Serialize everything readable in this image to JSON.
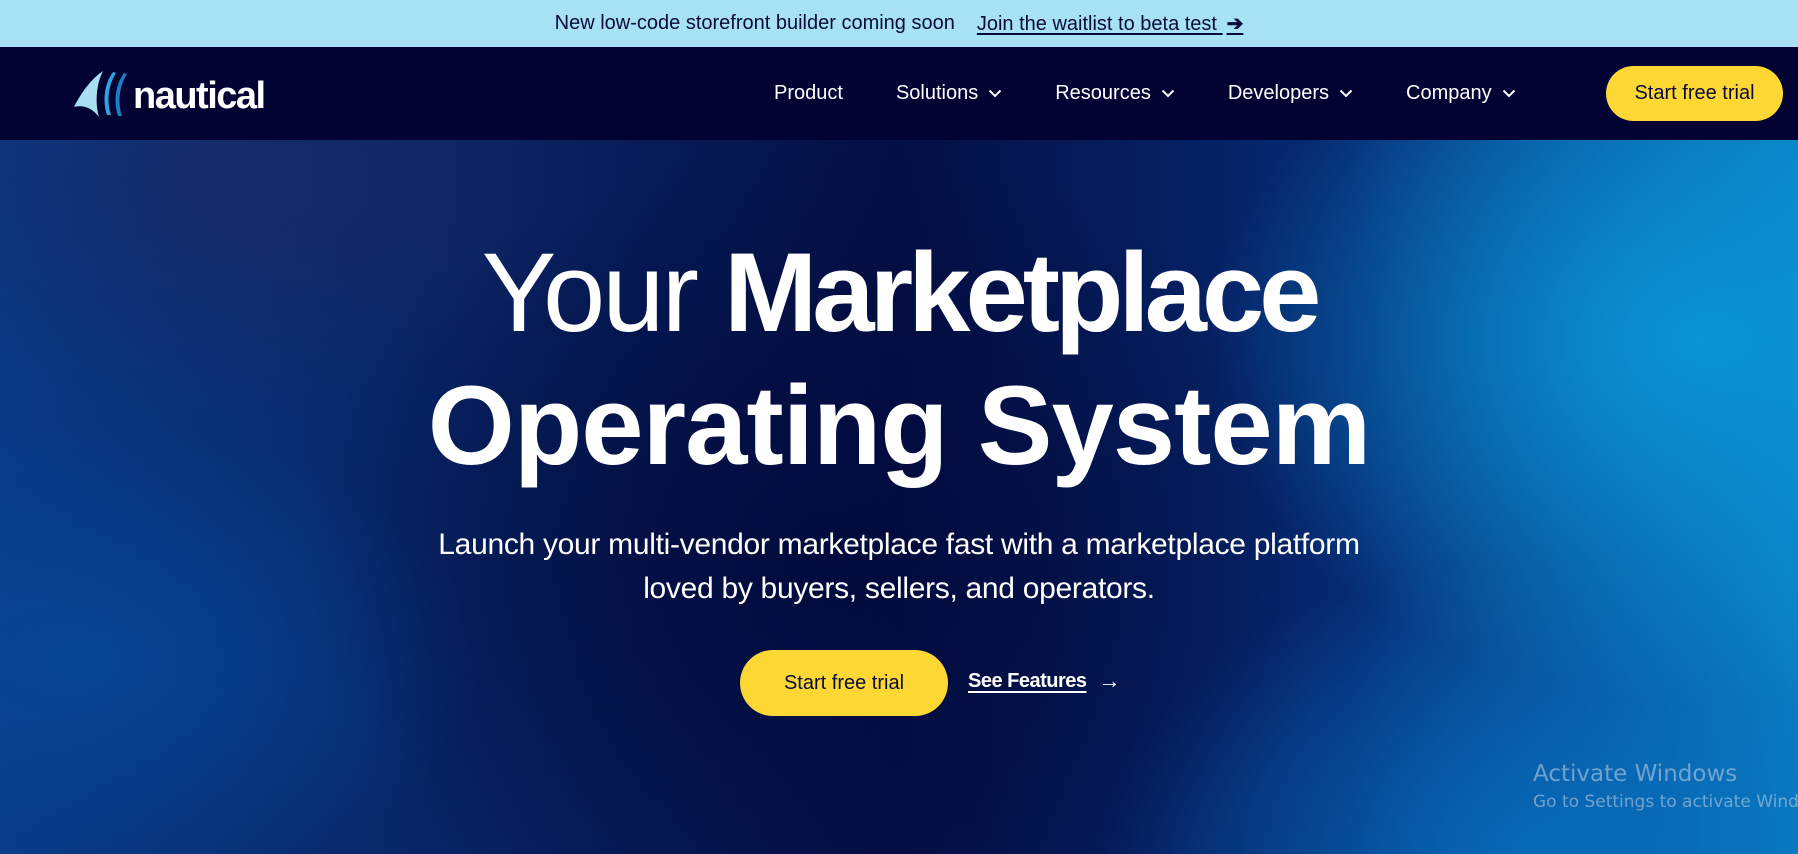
{
  "announcement": {
    "message": "New low-code storefront builder coming soon",
    "link_label": "Join the waitlist to beta test",
    "link_arrow": "➔"
  },
  "header": {
    "logo_text": "nautical",
    "logo_icon": "sail-icon",
    "nav_items": [
      {
        "label": "Product",
        "has_dropdown": false
      },
      {
        "label": "Solutions",
        "has_dropdown": true
      },
      {
        "label": "Resources",
        "has_dropdown": true
      },
      {
        "label": "Developers",
        "has_dropdown": true
      },
      {
        "label": "Company",
        "has_dropdown": true
      }
    ],
    "cta_label": "Start free trial"
  },
  "hero": {
    "headline_light": "Your ",
    "headline_bold": "Marketplace",
    "headline_line2": "Operating System",
    "subtitle_line1": "Launch your multi-vendor marketplace fast with a marketplace platform",
    "subtitle_line2": "loved by buyers, sellers, and operators.",
    "primary_cta": "Start free trial",
    "secondary_cta": "See Features",
    "secondary_arrow": "→"
  },
  "os_watermark": {
    "title": "Activate Windows",
    "subtitle": "Go to Settings to activate Windows."
  },
  "colors": {
    "announcement_bg": "#a6e1f4",
    "nav_bg": "#020233",
    "accent_yellow": "#fdd835",
    "text_dark": "#0a0a3a"
  }
}
